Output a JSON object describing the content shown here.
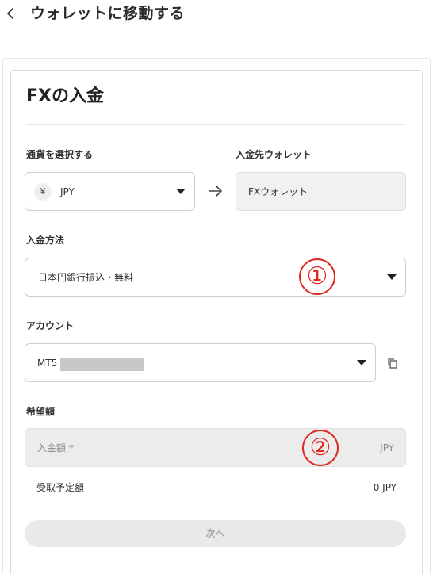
{
  "header": {
    "title": "ウォレットに移動する"
  },
  "form": {
    "title": "FXの入金",
    "currency": {
      "label": "通貨を選択する",
      "symbol": "¥",
      "value": "JPY"
    },
    "destination": {
      "label": "入金先ウォレット",
      "value": "FXウォレット"
    },
    "method": {
      "label": "入金方法",
      "value": "日本円銀行振込・無料"
    },
    "account": {
      "label": "アカウント",
      "value": "MT5"
    },
    "amount": {
      "label": "希望額",
      "placeholder": "入金額 *",
      "unit": "JPY"
    },
    "receive": {
      "label": "受取予定額",
      "value": "0 JPY"
    },
    "next_label": "次へ"
  },
  "annotations": {
    "marker_1": "①",
    "marker_2": "②",
    "color": "#e0281e"
  },
  "icons": [
    "chevron-left-icon",
    "arrow-right-icon",
    "caret-down-icon",
    "copy-icon"
  ]
}
